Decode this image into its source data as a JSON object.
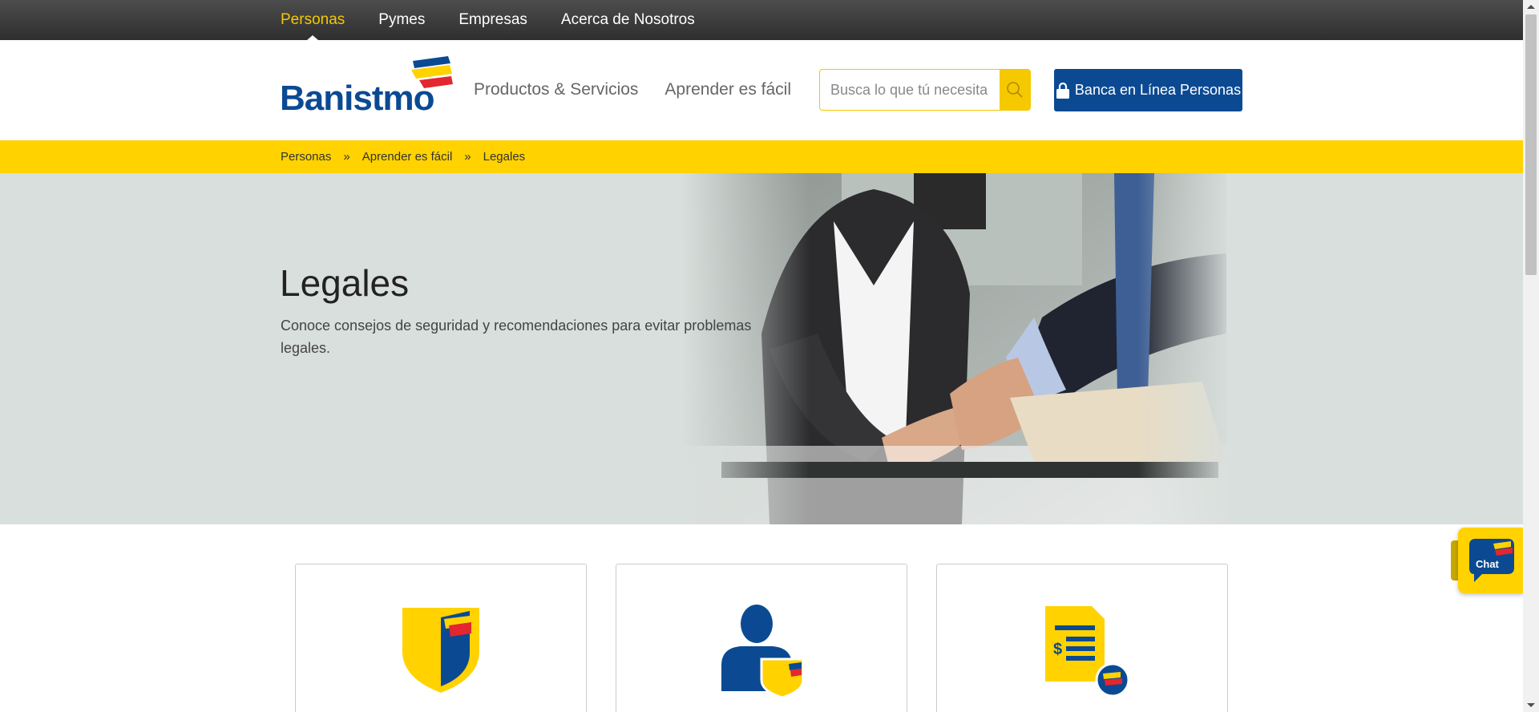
{
  "topnav": {
    "items": [
      {
        "label": "Personas",
        "active": true
      },
      {
        "label": "Pymes"
      },
      {
        "label": "Empresas"
      },
      {
        "label": "Acerca de Nosotros"
      }
    ]
  },
  "header": {
    "logo_text": "Banistmo",
    "nav": [
      {
        "label": "Productos & Servicios"
      },
      {
        "label": "Aprender es fácil"
      }
    ],
    "search": {
      "placeholder": "Busca lo que tú necesitas",
      "icon": "search-icon"
    },
    "login_button": {
      "label": "Banca en Línea Personas",
      "icon": "lock-icon"
    }
  },
  "breadcrumb": {
    "items": [
      "Personas",
      "Aprender es fácil",
      "Legales"
    ],
    "separator": "»"
  },
  "hero": {
    "title": "Legales",
    "description": "Conoce consejos de seguridad y recomendaciones para evitar problemas legales.",
    "image": "handshake-photo"
  },
  "cards": [
    {
      "icon": "shield-icon"
    },
    {
      "icon": "user-protection-icon"
    },
    {
      "icon": "document-payment-icon"
    }
  ],
  "chat": {
    "label": "Chat"
  },
  "colors": {
    "brand_blue": "#0b4a93",
    "brand_yellow": "#ffd200",
    "brand_red": "#e3262f",
    "topbar": "#3a3a3a"
  }
}
